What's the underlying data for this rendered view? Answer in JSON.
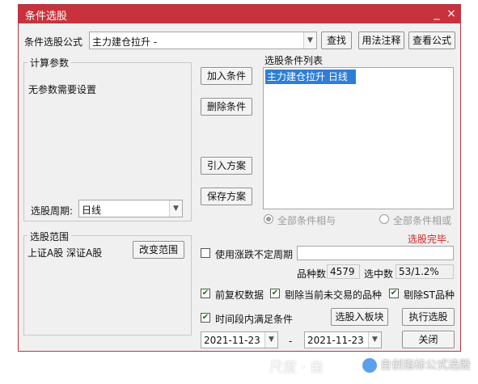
{
  "window": {
    "title": "条件选股",
    "minimize_glyph": "_",
    "close_glyph": "×"
  },
  "formula": {
    "label": "条件选股公式",
    "value": "主力建仓拉升 -",
    "find_button": "查找",
    "usage_button": "用法注释",
    "view_button": "查看公式"
  },
  "params": {
    "group_title": "计算参数",
    "message": "无参数需要设置",
    "period_label": "选股周期:",
    "period_value": "日线"
  },
  "actions": {
    "add_condition": "加入条件",
    "delete_condition": "删除条件",
    "import_plan": "引入方案",
    "save_plan": "保存方案"
  },
  "condition_list": {
    "title": "选股条件列表",
    "items": [
      "主力建仓拉升  日线"
    ],
    "logic_and": "全部条件相与",
    "logic_or": "全部条件相或",
    "status": "选股完毕."
  },
  "range": {
    "group_title": "选股范围",
    "value": "上证A股 深证A股",
    "change_button": "改变范围"
  },
  "options": {
    "uncertain_period_label": "使用涨跌不定周期",
    "uncertain_period_value": "",
    "variety_count_label": "品种数",
    "variety_count_value": "4579",
    "selected_label": "选中数",
    "selected_value": "53/1.2%",
    "pre_adjust_label": "前复权数据",
    "exclude_untraded_label": "剔除当前未交易的品种",
    "exclude_st_label": "剔除ST品种",
    "time_range_label": "时间段内满足条件",
    "to_sector_button": "选股入板块",
    "execute_button": "执行选股",
    "close_button": "关闭",
    "date_start": "2021-11-23",
    "date_separator": "-",
    "date_end": "2021-11-23"
  },
  "watermark": {
    "left_text": "尺度 · 自",
    "right_text": "自创指标公式选股"
  },
  "colors": {
    "titlebar": "#c8323d",
    "selection": "#2e7ed6",
    "status": "#d22424"
  }
}
